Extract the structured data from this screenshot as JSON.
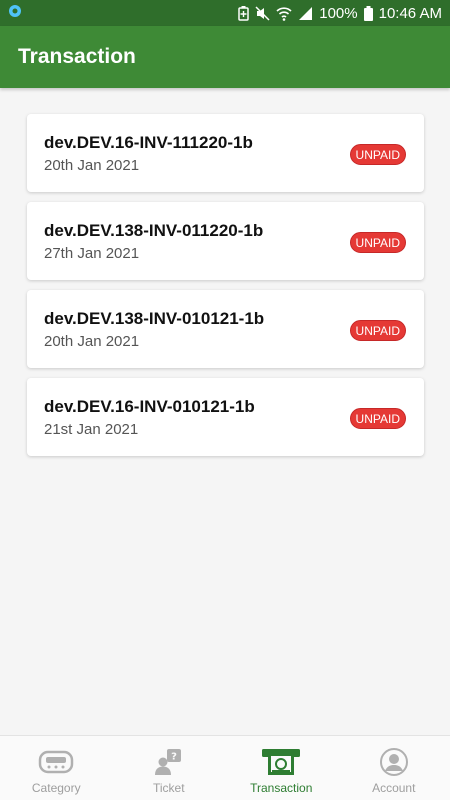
{
  "status_bar": {
    "battery_percent": "100%",
    "time": "10:46 AM"
  },
  "app_bar": {
    "title": "Transaction"
  },
  "transactions": [
    {
      "invoice": "dev.DEV.16-INV-111220-1b",
      "date": "20th Jan 2021",
      "status": "UNPAID"
    },
    {
      "invoice": "dev.DEV.138-INV-011220-1b",
      "date": "27th Jan 2021",
      "status": "UNPAID"
    },
    {
      "invoice": "dev.DEV.138-INV-010121-1b",
      "date": "20th Jan 2021",
      "status": "UNPAID"
    },
    {
      "invoice": "dev.DEV.16-INV-010121-1b",
      "date": "21st Jan 2021",
      "status": "UNPAID"
    }
  ],
  "bottom_nav": {
    "items": [
      {
        "label": "Category",
        "icon": "category-icon",
        "active": false
      },
      {
        "label": "Ticket",
        "icon": "ticket-icon",
        "active": false
      },
      {
        "label": "Transaction",
        "icon": "transaction-icon",
        "active": true
      },
      {
        "label": "Account",
        "icon": "account-icon",
        "active": false
      }
    ]
  },
  "colors": {
    "status_bar": "#2f6e2b",
    "app_bar": "#3e8a36",
    "unpaid_badge": "#e53935",
    "nav_active": "#2e7d32",
    "nav_inactive": "#9e9e9e"
  }
}
